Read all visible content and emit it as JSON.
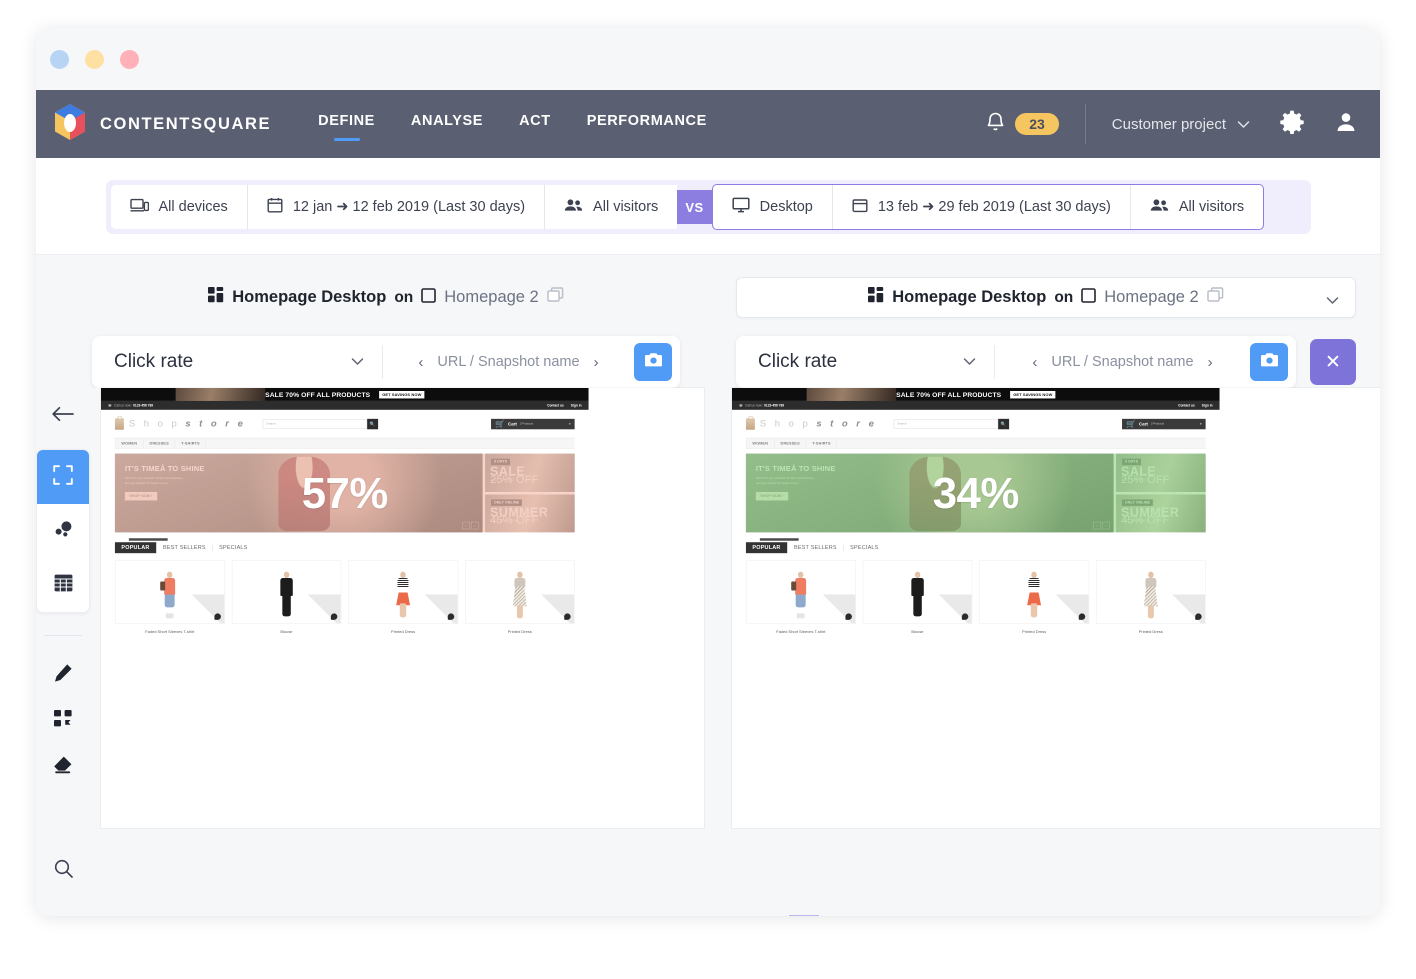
{
  "window_dots": [
    "blue",
    "yellow",
    "red"
  ],
  "topnav": {
    "brand": "CONTENTSQUARE",
    "logo_icon": "contentsquare-cube-icon",
    "links": [
      {
        "label": "DEFINE",
        "active": true
      },
      {
        "label": "ANALYSE",
        "active": false
      },
      {
        "label": "ACT",
        "active": false
      },
      {
        "label": "PERFORMANCE",
        "active": false
      }
    ],
    "bell_icon": "bell-icon",
    "notification_count": "23",
    "project": "Customer project",
    "project_caret": "chevron-down-icon",
    "gear_icon": "gear-icon",
    "user_icon": "user-icon"
  },
  "filters": {
    "left": {
      "device_icon": "devices-icon",
      "device": "All devices",
      "calendar_icon": "calendar-icon",
      "date_range": "12 jan ➜ 12 feb 2019 (Last 30 days)",
      "segment_icon": "people-icon",
      "segment": "All visitors"
    },
    "vs_label": "VS",
    "right": {
      "device_icon": "desktop-icon",
      "device": "Desktop",
      "calendar_icon": "calendar-icon",
      "date_range": "13 feb ➜ 29 feb 2019 (Last 30 days)",
      "segment_icon": "people-icon",
      "segment": "All visitors"
    }
  },
  "titles": {
    "left": {
      "zone_icon": "zoning-grid-icon",
      "zone": "Homepage Desktop",
      "on": "on",
      "page_icon": "page-square-icon",
      "page": "Homepage 2",
      "copy_icon": "duplicate-icon"
    },
    "right": {
      "zone_icon": "zoning-grid-icon",
      "zone": "Homepage Desktop",
      "on": "on",
      "page_icon": "page-square-icon",
      "page": "Homepage 2",
      "copy_icon": "duplicate-icon",
      "caret_icon": "chevron-down-icon"
    }
  },
  "toolbars": {
    "left": {
      "metric": "Click rate",
      "metric_caret": "chevron-down-icon",
      "prev_icon": "chevron-left-icon",
      "pager_label": "URL / Snapshot name",
      "next_icon": "chevron-right-icon",
      "camera_icon": "camera-icon"
    },
    "right": {
      "metric": "Click rate",
      "metric_caret": "chevron-down-icon",
      "prev_icon": "chevron-left-icon",
      "pager_label": "URL / Snapshot name",
      "next_icon": "chevron-right-icon",
      "camera_icon": "camera-icon",
      "close_label": "✕"
    }
  },
  "sidebar": {
    "back_icon": "arrow-left-icon",
    "tools": [
      {
        "icon": "zoning-frame-icon",
        "active": true
      },
      {
        "icon": "bubbles-icon",
        "active": false
      },
      {
        "icon": "table-grid-icon",
        "active": false
      }
    ],
    "secondary": [
      {
        "icon": "pencil-icon"
      },
      {
        "icon": "crop-icon"
      },
      {
        "icon": "eraser-icon"
      }
    ],
    "zoom_icon": "magnifier-icon"
  },
  "mockup": {
    "promo_text": "SALE 70% OFF ALL PRODUCTS",
    "promo_button": "GET SAVINGS NOW",
    "util_phone_label": "Call us now:",
    "util_phone": "0123-456 789",
    "util_links": [
      "Contact us",
      "Sign in"
    ],
    "logo_part1": "S h o p",
    "logo_part2": "s t o r e",
    "search_placeholder": "Search",
    "search_icon": "search-icon",
    "cart_icon": "cart-icon",
    "cart_label": "Cart",
    "cart_count": "3 Products",
    "cart_caret": "chevron-down-icon",
    "nav": [
      "WOMEN",
      "DRESSES",
      "T-SHIRTS"
    ],
    "hero": {
      "heading": "IT'S TIMEÅ TO SHINE",
      "paragraph": "Pick from our selection of flirty and fabulous, and get readyÅ for heads to turn",
      "button": "SHOP NOW !",
      "prev_icon": "chevron-left-icon",
      "next_icon": "chevron-right-icon"
    },
    "cards": [
      {
        "tag": "3 DAYS",
        "big": "SALE",
        "small": "GET UP TO",
        "pct": "25% OFF"
      },
      {
        "tag": "ONLY ONLINE",
        "big": "SUMMER",
        "small": "COLLECTION",
        "pct": "45% OFF"
      }
    ],
    "tabs": [
      {
        "label": "POPULAR",
        "active": true
      },
      {
        "label": "BEST SELLERS",
        "active": false
      },
      {
        "label": "SPECIALS",
        "active": false
      }
    ],
    "products": [
      {
        "name": "Faded Short Sleeves T-shirt",
        "fig": "f1"
      },
      {
        "name": "Blouse",
        "fig": "f2"
      },
      {
        "name": "Printed Dress",
        "fig": "f3"
      },
      {
        "name": "Printed Dress",
        "fig": "f4"
      }
    ]
  },
  "heatmaps": {
    "left": {
      "value": "57%",
      "tint": "pink",
      "tint_color": "#f0baaa"
    },
    "right": {
      "value": "34%",
      "tint": "green",
      "tint_color": "#96d78c"
    }
  },
  "colors": {
    "navbar": "#5a6072",
    "accent_blue": "#4f9bf5",
    "accent_purple": "#7d73d8",
    "badge_yellow": "#f5c560",
    "filter_bg": "#f0eefc"
  }
}
